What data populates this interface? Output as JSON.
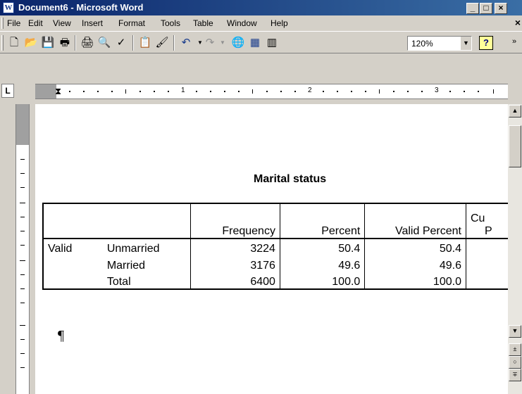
{
  "window": {
    "title": "Document6 - Microsoft Word",
    "app_icon": "W",
    "minimize": "_",
    "maximize": "□",
    "close": "×"
  },
  "menu": {
    "items": [
      "File",
      "Edit",
      "View",
      "Insert",
      "Format",
      "Tools",
      "Table",
      "Window",
      "Help"
    ],
    "close_doc": "×"
  },
  "toolbar": {
    "icons": [
      "new-icon",
      "open-icon",
      "save-icon",
      "permission-icon",
      "print-icon",
      "print-preview-icon",
      "spelling-icon",
      "paste-icon",
      "format-painter-icon",
      "undo-icon",
      "redo-icon",
      "hyperlink-icon",
      "table-icon",
      "columns-icon"
    ],
    "zoom": "120%",
    "help": "?"
  },
  "ruler": {
    "tab_selector": "L",
    "numbers": [
      "1",
      "2",
      "3"
    ]
  },
  "document": {
    "table_title": "Marital status",
    "header": [
      "",
      "",
      "Frequency",
      "Percent",
      "Valid Percent",
      "Cu"
    ],
    "header2_last": "P",
    "rows": [
      [
        "Valid",
        "Unmarried",
        "3224",
        "50.4",
        "50.4",
        ""
      ],
      [
        "",
        "Married",
        "3176",
        "49.6",
        "49.6",
        ""
      ],
      [
        "",
        "Total",
        "6400",
        "100.0",
        "100.0",
        ""
      ]
    ],
    "pilcrow": "¶"
  }
}
